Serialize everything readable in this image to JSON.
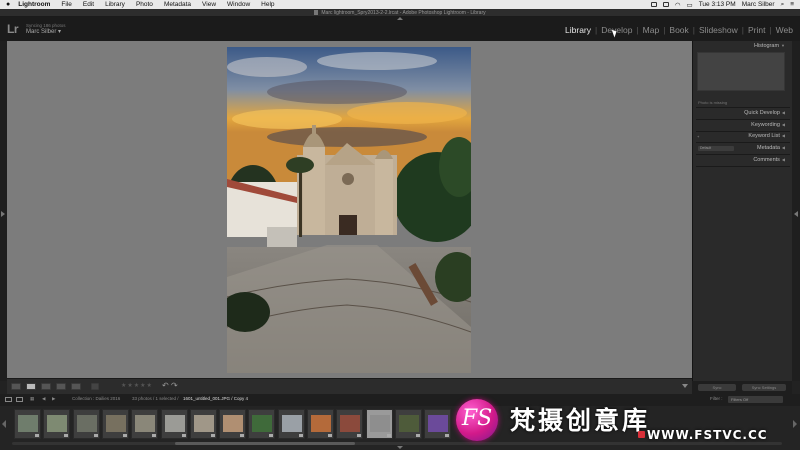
{
  "menubar": {
    "app_name": "Lightroom",
    "items": [
      "File",
      "Edit",
      "Library",
      "Photo",
      "Metadata",
      "View",
      "Window",
      "Help"
    ],
    "clock": "Tue 3:13 PM",
    "user": "Marc Silber"
  },
  "window": {
    "title": "Marc lightroom_Spry2013-2-2.lrcat - Adobe Photoshop Lightroom - Library"
  },
  "identity": {
    "logo": "Lr",
    "sync_status": "Syncing 186 photos",
    "user_name": "Marc Silber ▾"
  },
  "modules": [
    "Library",
    "Develop",
    "Map",
    "Book",
    "Slideshow",
    "Print",
    "Web"
  ],
  "active_module": "Library",
  "right_panel": {
    "histogram": "Histogram",
    "photo_missing": "Photo is missing",
    "quick_develop": "Quick Develop",
    "keywording": "Keywording",
    "keyword_list": "Keyword List",
    "metadata": "Metadata",
    "metadata_preset": "Default",
    "comments": "Comments",
    "sync_button": "Sync",
    "sync_settings_button": "Sync Settings"
  },
  "toolbar": {
    "stars": "★★★★★"
  },
  "filmstrip_header": {
    "collection": "Collection : Dailies 2016",
    "count": "33 photos / 1 selected /",
    "filename": "1601_untitled_001.JPG / Copy 4",
    "filter_label": "Filter :",
    "filter_value": "Filters Off"
  },
  "filmstrip": {
    "thumb_colors": [
      "#6f7d6c",
      "#7e8a72",
      "#6a6e63",
      "#77705f",
      "#8a8779",
      "#9b9b96",
      "#a09788",
      "#b08f72",
      "#3f6a3a",
      "#9aa0a6",
      "#b46a3a",
      "#8b4a3c",
      "#8e8e8e",
      "#4e5b3a",
      "#6b4a9a"
    ],
    "selected_index": 12
  },
  "watermark": {
    "logo_text": "FS",
    "chinese": "梵摄创意库",
    "url": "WWW.FSTVC.CC"
  }
}
